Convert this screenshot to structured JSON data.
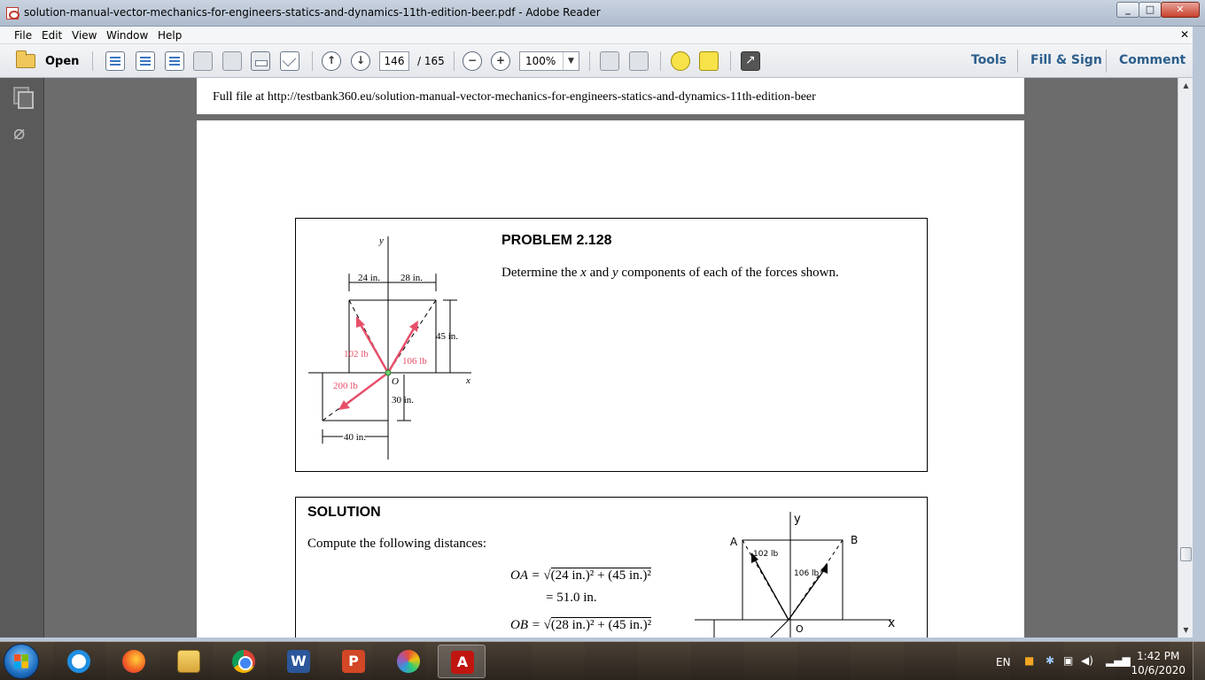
{
  "window": {
    "title": "solution-manual-vector-mechanics-for-engineers-statics-and-dynamics-11th-edition-beer.pdf - Adobe Reader"
  },
  "menu": [
    "File",
    "Edit",
    "View",
    "Window",
    "Help"
  ],
  "toolbar": {
    "open_label": "Open",
    "page_current": "146",
    "page_total": "/ 165",
    "zoom": "100%",
    "zoom_out": "−",
    "zoom_in": "+",
    "tools": "Tools",
    "fill_sign": "Fill & Sign",
    "comment": "Comment"
  },
  "document": {
    "header": "Full file at http://testbank360.eu/solution-manual-vector-mechanics-for-engineers-statics-and-dynamics-11th-edition-beer",
    "problem_title": "PROBLEM 2.128",
    "problem_text_1": "Determine the ",
    "problem_x": "x",
    "problem_text_2": " and ",
    "problem_y": "y",
    "problem_text_3": " components of each of the forces shown.",
    "figure": {
      "axis_y": "y",
      "axis_x": "x",
      "dim_24": "24 in.",
      "dim_28": "28 in.",
      "dim_45": "45 in.",
      "dim_30": "30 in.",
      "dim_40": "40 in.",
      "f102": "102 lb",
      "f106": "106 lb",
      "f200": "200 lb",
      "origin": "O"
    },
    "solution_title": "SOLUTION",
    "solution_text": "Compute the following distances:",
    "eq1_lhs": "OA =",
    "eq1_rhs": "(24 in.)² + (45 in.)²",
    "eq1_result": "= 51.0 in.",
    "eq2_lhs": "OB =",
    "eq2_rhs": "(28 in.)² + (45 in.)²",
    "sketch": {
      "y": "y",
      "a": "A",
      "b": "B",
      "f102": "102 lb",
      "f106": "106 lb",
      "x": "x",
      "o": "O"
    }
  },
  "taskbar": {
    "lang": "EN",
    "time": "1:42 PM",
    "date": "10/6/2020"
  }
}
